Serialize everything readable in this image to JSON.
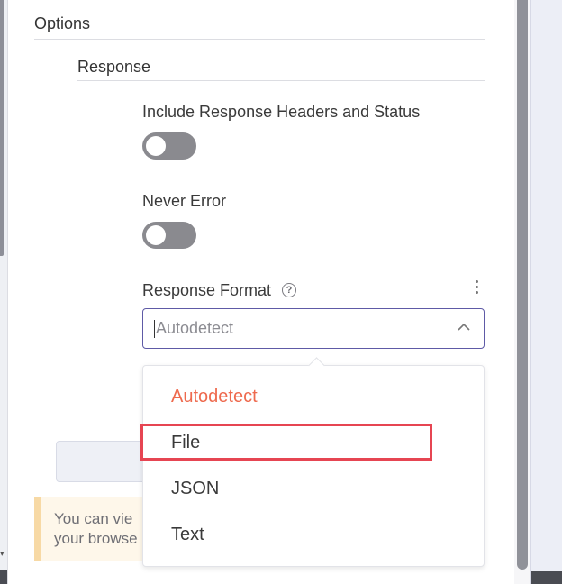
{
  "options": {
    "title": "Options",
    "response": {
      "title": "Response",
      "include_headers": {
        "label": "Include Response Headers and Status",
        "enabled": false
      },
      "never_error": {
        "label": "Never Error",
        "enabled": false
      },
      "response_format": {
        "label": "Response Format",
        "help_icon": "question-circle-icon",
        "menu_icon": "kebab-menu-icon",
        "placeholder": "Autodetect",
        "value": "",
        "expanded": true,
        "options": [
          {
            "label": "Autodetect",
            "selected": true
          },
          {
            "label": "File",
            "selected": false,
            "highlighted": true
          },
          {
            "label": "JSON",
            "selected": false
          },
          {
            "label": "Text",
            "selected": false
          }
        ]
      }
    }
  },
  "notice": {
    "line1": "You can vie",
    "line2": "your browse"
  },
  "colors": {
    "accent": "#5e5aa6",
    "selected_option": "#ee6a4e",
    "highlight": "#e64552",
    "toggle_off": "#8a8a8f",
    "notice_border": "#f7d9a5"
  }
}
